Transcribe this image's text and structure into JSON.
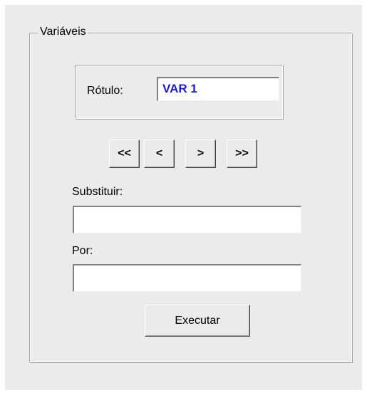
{
  "group": {
    "title": "Variáveis"
  },
  "rotulo": {
    "label": "Rótulo:",
    "value": "VAR 1",
    "value_color": "#1a1ae6"
  },
  "navigation": {
    "first_label": "<<",
    "prev_label": "<",
    "next_label": ">",
    "last_label": ">>"
  },
  "substituir": {
    "label": "Substituir:",
    "value": ""
  },
  "por": {
    "label": "Por:",
    "value": ""
  },
  "actions": {
    "execute_label": "Executar"
  }
}
